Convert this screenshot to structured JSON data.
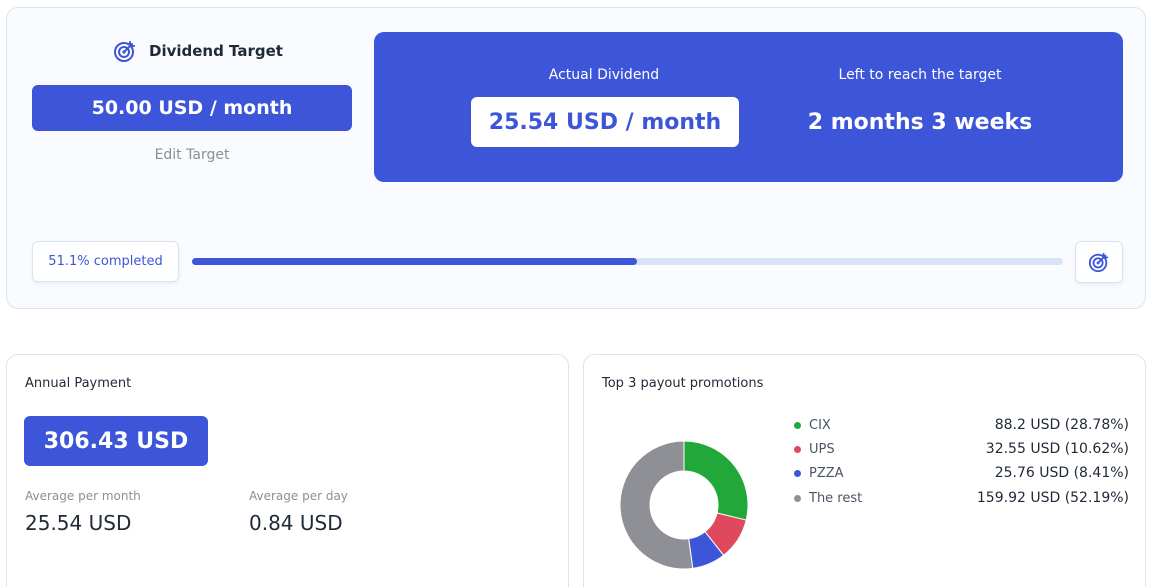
{
  "target": {
    "title": "Dividend Target",
    "amount": "50.00 USD / month",
    "edit_label": "Edit Target",
    "actual_label": "Actual Dividend",
    "actual_value": "25.54 USD / month",
    "left_label": "Left to reach the target",
    "left_value": "2 months 3 weeks",
    "progress_text": "51.1% completed",
    "progress_fraction": 0.511,
    "icon": "target-icon"
  },
  "annual": {
    "title": "Annual Payment",
    "amount": "306.43 USD",
    "avg_month_label": "Average per month",
    "avg_month_value": "25.54 USD",
    "avg_day_label": "Average per day",
    "avg_day_value": "0.84 USD"
  },
  "top3": {
    "title": "Top 3 payout promotions",
    "items": [
      {
        "name": "CIX",
        "value": "88.2 USD (28.78%)",
        "share": 28.78,
        "color": "#22a83a"
      },
      {
        "name": "UPS",
        "value": "32.55 USD (10.62%)",
        "share": 10.62,
        "color": "#e0485d"
      },
      {
        "name": "PZZA",
        "value": "25.76 USD (8.41%)",
        "share": 8.41,
        "color": "#3d55d9"
      },
      {
        "name": "The rest",
        "value": "159.92 USD (52.19%)",
        "share": 52.19,
        "color": "#8e9096"
      }
    ]
  },
  "colors": {
    "accent": "#3d55d9",
    "track": "#d9e2f6",
    "border": "#d6e6ee"
  }
}
